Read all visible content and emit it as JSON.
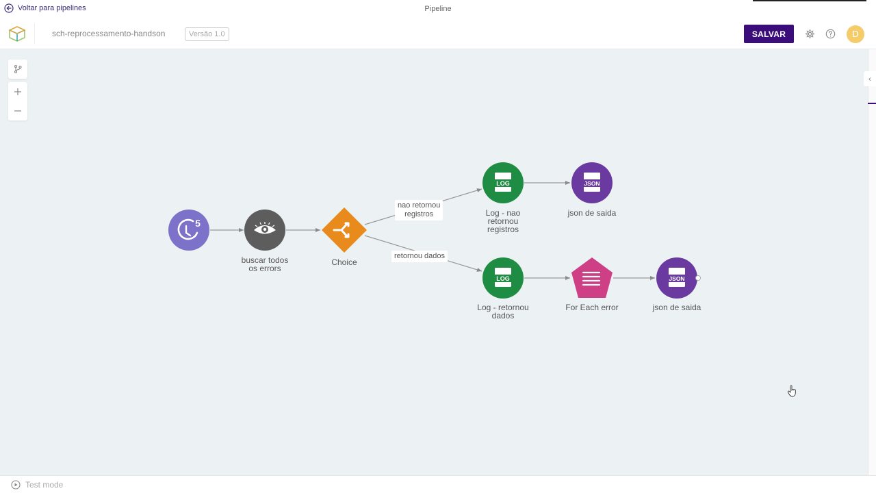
{
  "topbar": {
    "back_label": "Voltar para pipelines",
    "title": "Pipeline"
  },
  "header": {
    "pipeline_name": "sch-reprocessamento-handson",
    "version": "Versão 1.0",
    "save_label": "SALVAR",
    "avatar_initial": "D"
  },
  "toolbar": {
    "icons": [
      "branch-icon",
      "zoom-in-icon",
      "zoom-out-icon"
    ]
  },
  "nodes": [
    {
      "name": "scheduler-node",
      "label": "",
      "icon": "scheduler-icon",
      "color": "#7c72c9"
    },
    {
      "name": "buscar-node",
      "label": "buscar todos\nos errors",
      "icon": "eye-icon",
      "color": "#5d5d5d"
    },
    {
      "name": "choice-node",
      "label": "Choice",
      "icon": "choice-icon",
      "color": "#e88b1c"
    },
    {
      "name": "log-nao-node",
      "label": "Log - nao\nretornou\nregistros",
      "icon": "log-icon",
      "color": "#1f8c43"
    },
    {
      "name": "json-1-node",
      "label": "json de saida",
      "icon": "json-icon",
      "color": "#6b3aa0"
    },
    {
      "name": "log-retornou-node",
      "label": "Log - retornou\ndados",
      "icon": "log-icon",
      "color": "#1f8c43"
    },
    {
      "name": "foreach-node",
      "label": "For Each error",
      "icon": "list-icon",
      "color": "#cf3f86"
    },
    {
      "name": "json-2-node",
      "label": "json de saida",
      "icon": "json-icon",
      "color": "#6b3aa0"
    }
  ],
  "edges": [
    {
      "label": "nao retornou\nregistros"
    },
    {
      "label": "retornou dados"
    }
  ],
  "icon_text": {
    "log": "LOG",
    "json": "JSON",
    "timer": "5"
  },
  "footer": {
    "test_mode_label": "Test mode"
  }
}
